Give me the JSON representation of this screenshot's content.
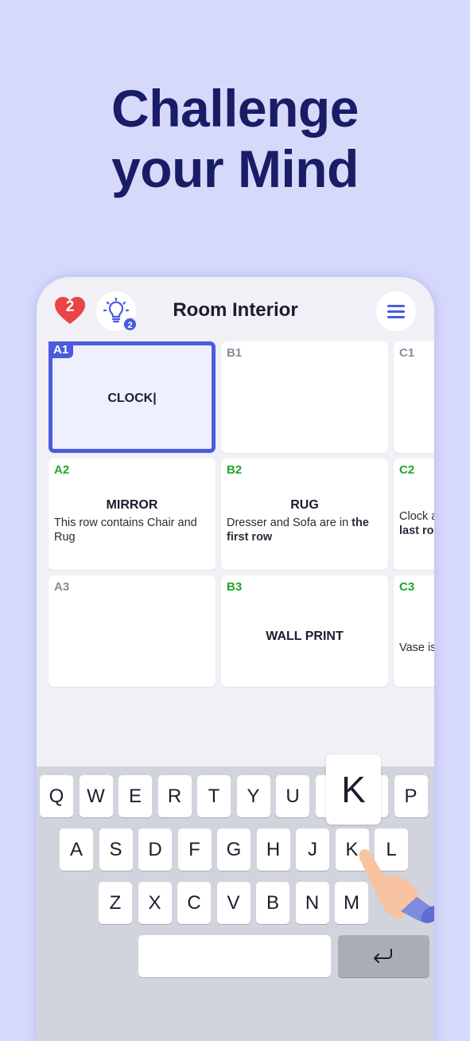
{
  "headline": [
    "Challenge",
    "your Mind"
  ],
  "header": {
    "lives": "2",
    "hints": "2",
    "title": "Room Interior"
  },
  "cards": [
    {
      "id": "A1",
      "answer": "CLOCK|",
      "clue": "",
      "selected": true,
      "solved": false
    },
    {
      "id": "B1",
      "answer": "",
      "clue": "",
      "solved": false
    },
    {
      "id": "C1",
      "answer": "",
      "clue": "",
      "solved": false
    },
    {
      "id": "A2",
      "answer": "MIRROR",
      "clue": "This row contains Chair and Rug",
      "solved": true
    },
    {
      "id": "B2",
      "answer": "RUG",
      "clue": "Dresser and Sofa are in ",
      "clue_bold": "the first row",
      "solved": true
    },
    {
      "id": "C2",
      "answer": "",
      "clue": "Clock a",
      "clue_bold": "same c\nlast ro",
      "solved": true
    },
    {
      "id": "A3",
      "answer": "",
      "clue": "",
      "solved": false
    },
    {
      "id": "B3",
      "answer": "WALL PRINT",
      "clue": "",
      "solved": true
    },
    {
      "id": "C3",
      "answer": "",
      "clue": "Vase is",
      "solved": true
    }
  ],
  "keyboard": {
    "rows": [
      [
        "Q",
        "W",
        "E",
        "R",
        "T",
        "Y",
        "U",
        "I",
        "O",
        "P"
      ],
      [
        "A",
        "S",
        "D",
        "F",
        "G",
        "H",
        "J",
        "K",
        "L"
      ],
      [
        "Z",
        "X",
        "C",
        "V",
        "B",
        "N",
        "M"
      ]
    ],
    "pressed": "K",
    "enter_icon": "return-arrow-icon"
  },
  "colors": {
    "accent": "#4a5be0",
    "solved": "#1fa52a",
    "heart": "#e84545",
    "headline": "#181d66"
  }
}
